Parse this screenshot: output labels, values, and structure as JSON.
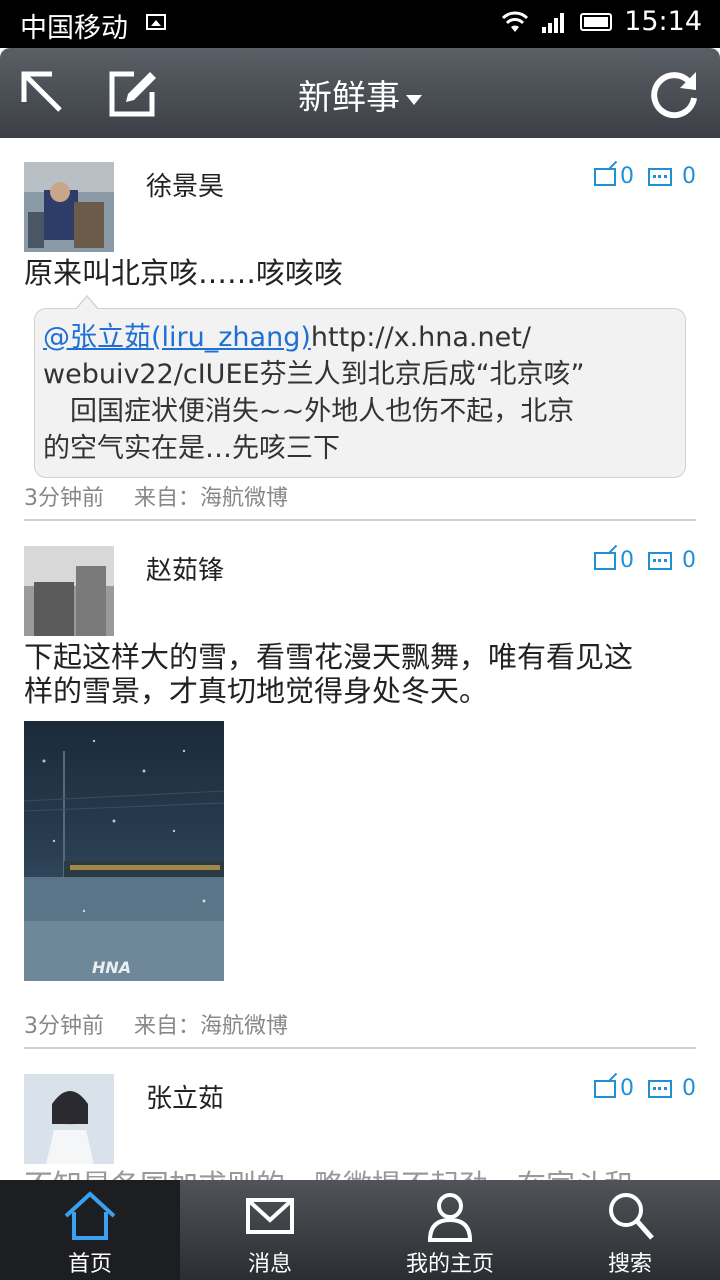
{
  "status_bar": {
    "carrier": "中国移动",
    "time": "15:14"
  },
  "header": {
    "title": "新鲜事"
  },
  "posts": [
    {
      "author": "徐景昊",
      "reposts": "0",
      "comments": "0",
      "text": "原来叫北京咳……咳咳咳",
      "quote": {
        "mention": "@张立茹(liru_zhang)",
        "line1_rest": "http://x.hna.net/",
        "line2": "webuiv22/cIUEE芬兰人到北京后成“北京咳”",
        "line3": "　回国症状便消失~~外地人也伤不起，北京",
        "line4": "的空气实在是…先咳三下"
      },
      "time": "3分钟前",
      "source": "来自：海航微博"
    },
    {
      "author": "赵茹锋",
      "reposts": "0",
      "comments": "0",
      "text_line1": "下起这样大的雪，看雪花漫天飘舞，唯有看见这",
      "text_line2": "样的雪景，才真切地觉得身处冬天。",
      "image_watermark": "HNA",
      "time": "3分钟前",
      "source": "来自：海航微博"
    },
    {
      "author": "张立茹",
      "reposts": "0",
      "comments": "0",
      "text": "不知是各国加求则的，略微提不起劲，在家斗和"
    }
  ],
  "bottom_nav": {
    "items": [
      {
        "label": "首页",
        "icon": "home-icon"
      },
      {
        "label": "消息",
        "icon": "envelope-icon"
      },
      {
        "label": "我的主页",
        "icon": "person-icon"
      },
      {
        "label": "搜索",
        "icon": "search-icon"
      }
    ],
    "active_index": 0
  },
  "colors": {
    "link": "#1f8fd6",
    "mention": "#1f6fd6",
    "header_bg": "#4a4f55",
    "nav_active": "#1c1e21"
  }
}
